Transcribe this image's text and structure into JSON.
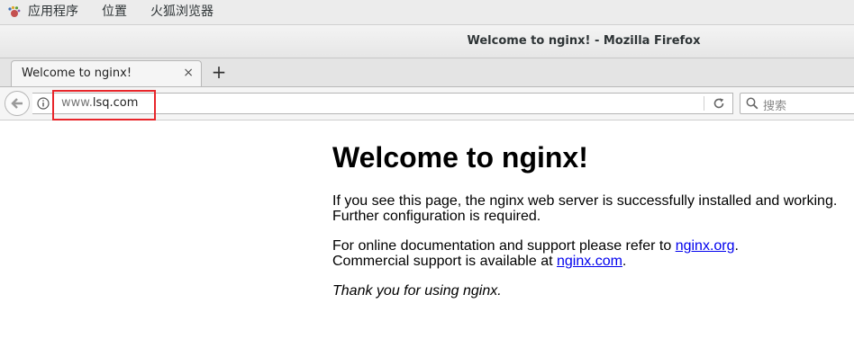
{
  "topbar": {
    "apps_menu": "应用程序",
    "places_menu": "位置",
    "firefox_menu": "火狐浏览器"
  },
  "window": {
    "title": "Welcome to nginx! - Mozilla Firefox"
  },
  "tabs": [
    {
      "label": "Welcome to nginx!",
      "close": "×"
    }
  ],
  "new_tab_label": "+",
  "navbar": {
    "url_prefix": "www.",
    "url_host": "lsq.com",
    "search_placeholder": "搜索"
  },
  "page": {
    "heading": "Welcome to nginx!",
    "para1_line1": "If you see this page, the nginx web server is successfully installed and working.",
    "para1_line2": "Further configuration is required.",
    "para2_line1_prefix": "For online documentation and support please refer to ",
    "para2_link1": "nginx.org",
    "para2_line1_suffix": ".",
    "para2_line2_prefix": "Commercial support is available at ",
    "para2_link2": "nginx.com",
    "para2_line2_suffix": ".",
    "para3": "Thank you for using nginx."
  },
  "colors": {
    "highlight_box": "#e8262b",
    "link": "#0000ee"
  },
  "icons": {
    "apps": "gnome-foot-icon",
    "back": "back-arrow-icon",
    "info": "info-icon",
    "reload": "reload-icon",
    "search": "search-icon",
    "close": "close-icon"
  }
}
